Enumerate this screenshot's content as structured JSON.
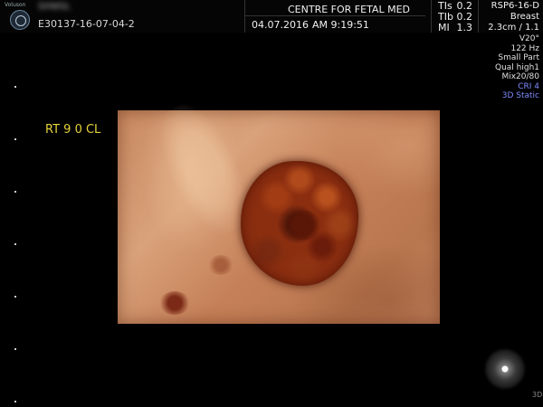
{
  "header": {
    "brand": "Voluson",
    "patient_name": "SHWSL",
    "exam_id": "E30137-16-07-04-2",
    "institution": "CENTRE FOR FETAL MED",
    "date": "04.07.2016",
    "time": "AM 9:19:51"
  },
  "safety": [
    {
      "label": "TIs",
      "value": "0.2"
    },
    {
      "label": "TIb",
      "value": "0.2"
    },
    {
      "label": "MI",
      "value": "1.3"
    }
  ],
  "probe": {
    "model": "RSP6-16-D",
    "preset": "Breast",
    "depth": "2.3cm / 1.1"
  },
  "params": {
    "angle": "V20°",
    "frequency": "122 Hz",
    "mode": "Small Part",
    "quality": "Qual high1",
    "mix": "Mix20/80",
    "cri": "CRI 4",
    "render_mode": "3D Static"
  },
  "view_label": "RT 9 0 CL",
  "corner_mark": "3D",
  "colors": {
    "label_yellow": "#e4d33a",
    "mode_blue": "#7f8cff"
  },
  "icons": {
    "logo": "ge-logo-icon",
    "trackball": "trackball-icon"
  }
}
